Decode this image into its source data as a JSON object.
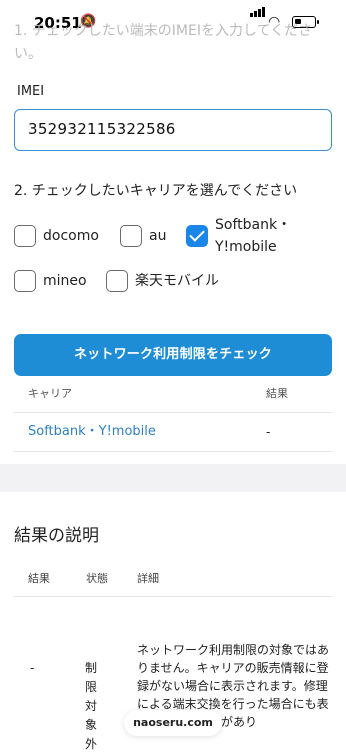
{
  "status_bar": {
    "time": "20:51"
  },
  "form": {
    "step1_label": "1. チェックしたい端末のIMEIを入力してください。",
    "imei_label": "IMEI",
    "imei_value": "352932115322586",
    "step2_label": "2. チェックしたいキャリアを選んでください",
    "carriers": [
      {
        "label": "docomo",
        "checked": false
      },
      {
        "label": "au",
        "checked": false
      },
      {
        "label": "Softbank・Y!mobile",
        "checked": true
      },
      {
        "label": "mineo",
        "checked": false
      },
      {
        "label": "楽天モバイル",
        "checked": false
      }
    ],
    "check_button": "ネットワーク利用制限をチェック"
  },
  "results_table": {
    "headers": [
      "キャリア",
      "結果"
    ],
    "rows": [
      {
        "carrier": "Softbank・Y!mobile",
        "result": "-"
      }
    ]
  },
  "explanation": {
    "title": "結果の説明",
    "headers": [
      "結果",
      "状態",
      "詳細"
    ],
    "rows": [
      {
        "result": "-",
        "status": "制限対象外",
        "detail": "ネットワーク利用制限の対象ではありません。キャリアの販売情報に登録がない場合に表示されます。修理による端末交換を行った場合にも表示される可能性があり"
      }
    ]
  },
  "browser": {
    "url": "naoseru.com"
  }
}
